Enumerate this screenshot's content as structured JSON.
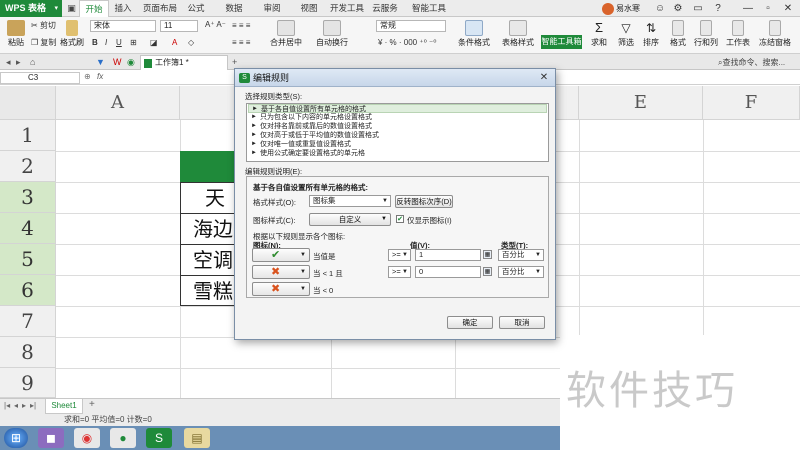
{
  "app": {
    "brand": "WPS 表格",
    "menu_tabs": [
      "开始",
      "插入",
      "页面布局",
      "公式",
      "数据",
      "审阅",
      "视图",
      "开发工具",
      "云服务",
      "智能工具箱"
    ],
    "active_tab": "开始",
    "user_name": "易水寒"
  },
  "ribbon": {
    "cut": "剪切",
    "copy": "复制",
    "paste": "粘贴",
    "format_painter": "格式刷",
    "font_name": "宋体",
    "font_size": "11",
    "number_format": "常规",
    "merge_center": "合并居中",
    "auto_wrap": "自动换行",
    "conditional_format": "条件格式",
    "table_style": "表格样式",
    "smart_toolbox": "智能工具箱",
    "sum": "求和",
    "filter": "筛选",
    "sort": "排序",
    "format": "格式",
    "rows_cols": "行和列",
    "worksheet": "工作表",
    "freeze": "冻结窗格"
  },
  "tabs": {
    "doc_title": "工作簿1 *",
    "add_tab": "+",
    "search": "查找命令、搜索..."
  },
  "formula_bar": {
    "cell_ref": "C3",
    "fx": "fx"
  },
  "grid": {
    "columns": [
      "A",
      "E",
      "F"
    ],
    "rows": [
      "1",
      "2",
      "3",
      "4",
      "5",
      "6",
      "7",
      "8",
      "9"
    ],
    "cells": [
      "天",
      "海边",
      "空调",
      "雪糕"
    ]
  },
  "sheets": {
    "sheet_name": "Sheet1",
    "add": "+"
  },
  "status": {
    "text": "求和=0  平均值=0  计数=0"
  },
  "watermark": "软件技巧",
  "dialog": {
    "title": "编辑规则",
    "select_rule_type": "选择规则类型(S):",
    "rule_types": [
      "基于各自值设置所有单元格的格式",
      "只为包含以下内容的单元格设置格式",
      "仅对排名靠前或靠后的数值设置格式",
      "仅对高于或低于平均值的数值设置格式",
      "仅对唯一值或重复值设置格式",
      "使用公式确定要设置格式的单元格"
    ],
    "edit_rule_desc": "编辑规则说明(E):",
    "desc_heading": "基于各自值设置所有单元格的格式:",
    "format_style_label": "格式样式(O):",
    "format_style_value": "图标集",
    "reverse_button": "反转图标次序(D)",
    "icon_style_label": "图标样式(C):",
    "icon_style_value": "自定义",
    "show_icon_only": "仅显示图标(I)",
    "rule_instruction": "根据以下规则显示各个图标:",
    "col_icon": "图标(N):",
    "col_value": "值(V):",
    "col_type": "类型(T):",
    "icon_rows": [
      {
        "icon": "✔",
        "icon_name": "check-icon",
        "color": "#2e8b2e",
        "text": "当值是",
        "op": ">=",
        "value": "1",
        "type": "百分比"
      },
      {
        "icon": "✖",
        "icon_name": "cross-icon",
        "color": "#d9531e",
        "text": "当 < 1 且",
        "op": ">=",
        "value": "0",
        "type": "百分比"
      },
      {
        "icon": "✖",
        "icon_name": "cross-icon",
        "color": "#d9531e",
        "text": "当 < 0",
        "op": "",
        "value": "",
        "type": ""
      }
    ],
    "ok_button": "确定",
    "cancel_button": "取消"
  }
}
